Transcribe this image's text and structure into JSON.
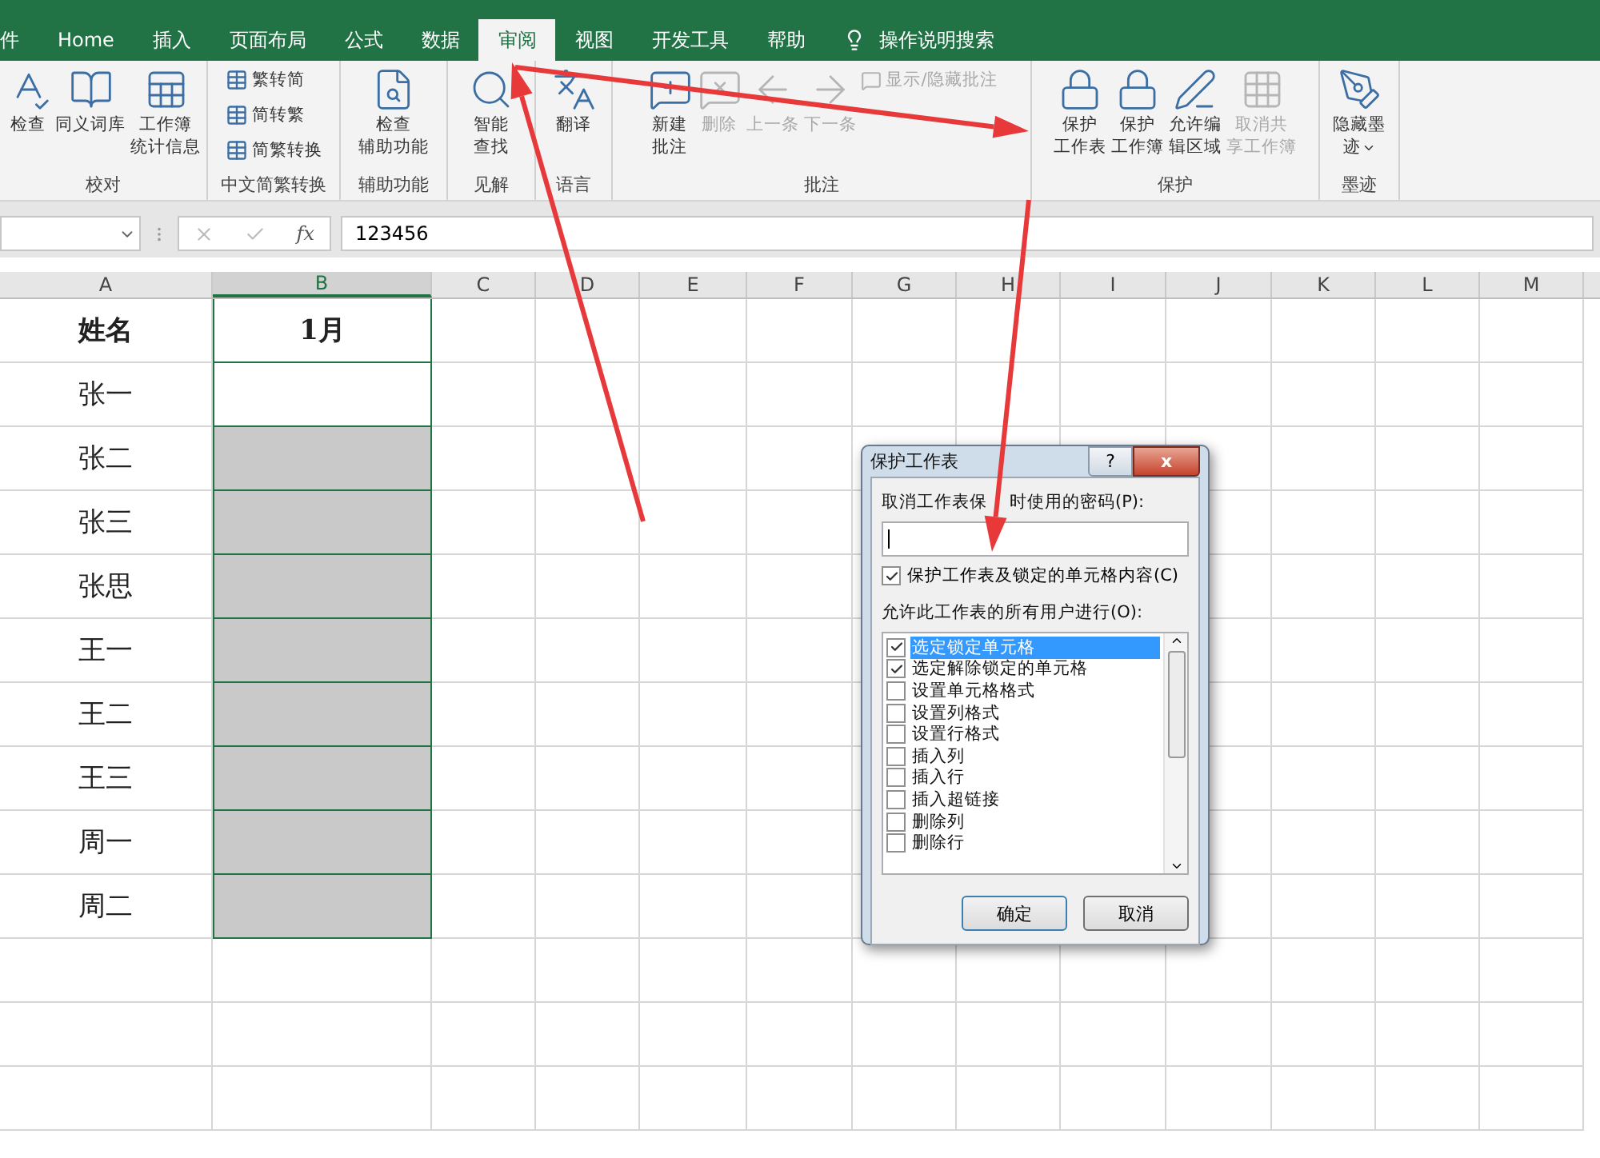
{
  "tabs": [
    {
      "label": "件",
      "selected": false
    },
    {
      "label": "Home",
      "selected": false
    },
    {
      "label": "插入",
      "selected": false
    },
    {
      "label": "页面布局",
      "selected": false
    },
    {
      "label": "公式",
      "selected": false
    },
    {
      "label": "数据",
      "selected": false
    },
    {
      "label": "审阅",
      "selected": true
    },
    {
      "label": "视图",
      "selected": false
    },
    {
      "label": "开发工具",
      "selected": false
    },
    {
      "label": "帮助",
      "selected": false
    }
  ],
  "tell_me": "操作说明搜索",
  "ribbon_groups": [
    {
      "name": "校对",
      "items": [
        {
          "kind": "large",
          "label": [
            "检查"
          ],
          "disabled": false
        },
        {
          "kind": "large",
          "label": [
            "同义词库"
          ],
          "disabled": false
        },
        {
          "kind": "large",
          "label": [
            "工作簿",
            "统计信息"
          ],
          "disabled": false
        }
      ]
    },
    {
      "name": "中文简繁转换",
      "items": [
        {
          "kind": "small",
          "label": "繁转简",
          "disabled": false
        },
        {
          "kind": "small",
          "label": "简转繁",
          "disabled": false
        },
        {
          "kind": "small",
          "label": "简繁转换",
          "disabled": false
        }
      ]
    },
    {
      "name": "辅助功能",
      "items": [
        {
          "kind": "large",
          "label": [
            "检查",
            "辅助功能"
          ],
          "disabled": false
        }
      ]
    },
    {
      "name": "见解",
      "items": [
        {
          "kind": "large",
          "label": [
            "智能",
            "查找"
          ],
          "disabled": false
        }
      ]
    },
    {
      "name": "语言",
      "items": [
        {
          "kind": "large",
          "label": [
            "翻译"
          ],
          "disabled": false
        }
      ]
    },
    {
      "name": "批注",
      "items": [
        {
          "kind": "large",
          "label": [
            "新建",
            "批注"
          ],
          "disabled": false
        },
        {
          "kind": "large",
          "label": [
            "删除"
          ],
          "disabled": true
        },
        {
          "kind": "large",
          "label": [
            "上一条"
          ],
          "disabled": true
        },
        {
          "kind": "large",
          "label": [
            "下一条"
          ],
          "disabled": true
        },
        {
          "kind": "small",
          "label": "显示/隐藏批注",
          "disabled": true
        }
      ]
    },
    {
      "name": "保护",
      "items": [
        {
          "kind": "large",
          "label": [
            "保护",
            "工作表"
          ],
          "disabled": false
        },
        {
          "kind": "large",
          "label": [
            "保护",
            "工作簿"
          ],
          "disabled": false
        },
        {
          "kind": "large",
          "label": [
            "允许编",
            "辑区域"
          ],
          "disabled": false
        },
        {
          "kind": "large",
          "label": [
            "取消共",
            "享工作簿"
          ],
          "disabled": true
        }
      ]
    },
    {
      "name": "墨迹",
      "items": [
        {
          "kind": "dropdown",
          "label": [
            "隐藏墨",
            "迹"
          ],
          "disabled": false
        }
      ]
    }
  ],
  "formula_bar": {
    "fx_label": "fx",
    "value": "123456"
  },
  "columns": [
    {
      "label": "A",
      "selected": false
    },
    {
      "label": "B",
      "selected": true
    },
    {
      "label": "C",
      "selected": false
    },
    {
      "label": "D",
      "selected": false
    },
    {
      "label": "E",
      "selected": false
    },
    {
      "label": "F",
      "selected": false
    },
    {
      "label": "G",
      "selected": false
    },
    {
      "label": "H",
      "selected": false
    },
    {
      "label": "I",
      "selected": false
    },
    {
      "label": "J",
      "selected": false
    },
    {
      "label": "K",
      "selected": false
    },
    {
      "label": "L",
      "selected": false
    },
    {
      "label": "M",
      "selected": false
    }
  ],
  "rows": [
    {
      "name": "姓名",
      "month": "1月",
      "header": true,
      "shaded": false
    },
    {
      "name": "张一",
      "header": false,
      "shaded": false
    },
    {
      "name": "张二",
      "header": false,
      "shaded": true
    },
    {
      "name": "张三",
      "header": false,
      "shaded": true
    },
    {
      "name": "张思",
      "header": false,
      "shaded": true
    },
    {
      "name": "王一",
      "header": false,
      "shaded": true
    },
    {
      "name": "王二",
      "header": false,
      "shaded": true
    },
    {
      "name": "王三",
      "header": false,
      "shaded": true
    },
    {
      "name": "周一",
      "header": false,
      "shaded": true
    },
    {
      "name": "周二",
      "header": false,
      "shaded": true
    }
  ],
  "dialog": {
    "title": "保护工作表",
    "help_button": "?",
    "close_button": "x",
    "password_label": [
      "取消工作表保",
      "时使用的密码(P):"
    ],
    "protect_option": {
      "label": "保护工作表及锁定的单元格内容(C)",
      "checked": true
    },
    "allow_label": "允许此工作表的所有用户进行(O):",
    "permissions": [
      {
        "label": "选定锁定单元格",
        "checked": true,
        "selected": true
      },
      {
        "label": "选定解除锁定的单元格",
        "checked": true,
        "selected": false
      },
      {
        "label": "设置单元格格式",
        "checked": false,
        "selected": false
      },
      {
        "label": "设置列格式",
        "checked": false,
        "selected": false
      },
      {
        "label": "设置行格式",
        "checked": false,
        "selected": false
      },
      {
        "label": "插入列",
        "checked": false,
        "selected": false
      },
      {
        "label": "插入行",
        "checked": false,
        "selected": false
      },
      {
        "label": "插入超链接",
        "checked": false,
        "selected": false
      },
      {
        "label": "删除列",
        "checked": false,
        "selected": false
      },
      {
        "label": "删除行",
        "checked": false,
        "selected": false
      }
    ],
    "ok_button": "确定",
    "cancel_button": "取消"
  }
}
